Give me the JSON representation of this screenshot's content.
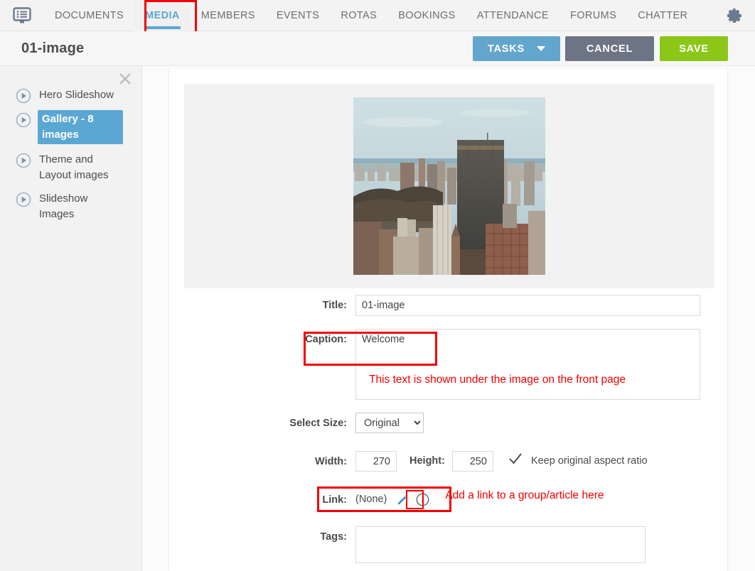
{
  "nav": {
    "logo_icon": "monitor-list-icon",
    "gear_icon": "gear-icon",
    "items": [
      {
        "label": "DOCUMENTS",
        "active": false
      },
      {
        "label": "MEDIA",
        "active": true
      },
      {
        "label": "MEMBERS",
        "active": false
      },
      {
        "label": "EVENTS",
        "active": false
      },
      {
        "label": "ROTAS",
        "active": false
      },
      {
        "label": "BOOKINGS",
        "active": false
      },
      {
        "label": "ATTENDANCE",
        "active": false
      },
      {
        "label": "FORUMS",
        "active": false
      },
      {
        "label": "CHATTER",
        "active": false
      }
    ]
  },
  "titlebar": {
    "title": "01-image",
    "tasks_label": "TASKS",
    "cancel_label": "CANCEL",
    "save_label": "SAVE"
  },
  "sidebar": {
    "close_icon": "close-icon",
    "items": [
      {
        "label": "Hero Slideshow",
        "selected": false,
        "icon": "play-circle-icon"
      },
      {
        "label": "Gallery - 8 images",
        "selected": true,
        "icon": "play-circle-icon"
      },
      {
        "label": "Theme and Layout images",
        "selected": false,
        "icon": "play-circle-icon"
      },
      {
        "label": "Slideshow Images",
        "selected": false,
        "icon": "play-circle-icon"
      }
    ]
  },
  "form": {
    "title_label": "Title:",
    "title_value": "01-image",
    "caption_label": "Caption:",
    "caption_value": "Welcome",
    "caption_annotation": "This text is shown under the image on the front page",
    "size_label": "Select Size:",
    "size_value": "Original",
    "size_options": [
      "Original"
    ],
    "width_label": "Width:",
    "width_value": "270",
    "height_label": "Height:",
    "height_value": "250",
    "aspect_icon": "check-icon",
    "aspect_label": "Keep original aspect ratio",
    "link_label": "Link:",
    "link_value": "(None)",
    "link_edit_icon": "pencil-icon",
    "link_info_icon": "info-circle-icon",
    "link_annotation": "Add a link to a group/article here",
    "tags_label": "Tags:",
    "tags_value": ""
  },
  "image": {
    "alt": "aerial cityscape photograph"
  },
  "colors": {
    "accent_blue": "#5ba7d4",
    "save_green": "#8cc717",
    "cancel_grey": "#6d7584",
    "annotation_red": "#f40000"
  }
}
